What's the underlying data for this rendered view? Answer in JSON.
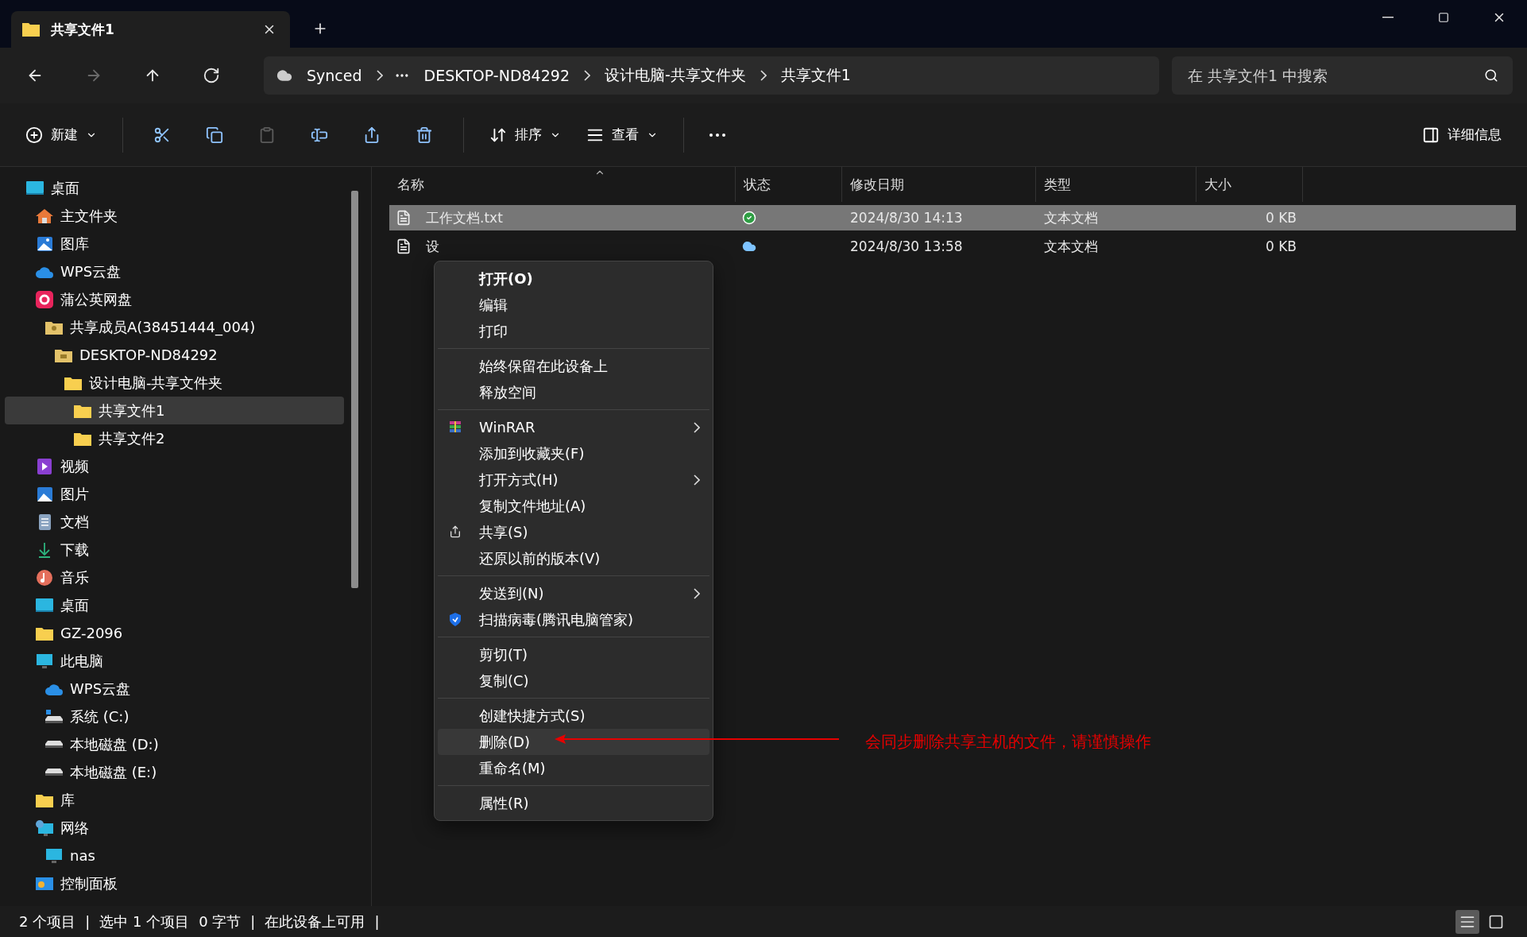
{
  "window": {
    "tab_title": "共享文件1"
  },
  "nav": [
    {
      "kind": "back",
      "disabled": false
    },
    {
      "kind": "forward",
      "disabled": true
    },
    {
      "kind": "up",
      "disabled": false
    },
    {
      "kind": "refresh",
      "disabled": false
    }
  ],
  "address": {
    "root": "Synced",
    "crumbs": [
      "DESKTOP-ND84292",
      "设计电脑-共享文件夹",
      "共享文件1"
    ]
  },
  "search": {
    "placeholder": "在 共享文件1 中搜索"
  },
  "toolbar": {
    "new_label": "新建",
    "actions": [
      {
        "kind": "cut",
        "disabled": false
      },
      {
        "kind": "copy",
        "disabled": false
      },
      {
        "kind": "paste",
        "disabled": true
      },
      {
        "kind": "rename",
        "disabled": false
      },
      {
        "kind": "share",
        "disabled": false
      },
      {
        "kind": "delete",
        "disabled": false
      }
    ],
    "sort_label": "排序",
    "view_label": "查看",
    "details_label": "详细信息"
  },
  "sidebar": {
    "items": [
      {
        "label": "桌面",
        "kind": "desktop",
        "selected": false,
        "children": [
          {
            "label": "主文件夹",
            "kind": "home",
            "selected": false
          },
          {
            "label": "图库",
            "kind": "gallery",
            "selected": false
          },
          {
            "label": "WPS云盘",
            "kind": "cloud",
            "selected": false
          },
          {
            "label": "蒲公英网盘",
            "kind": "dandelion",
            "selected": false,
            "children": [
              {
                "label": "共享成员A(38451444_004)",
                "kind": "shared-folder",
                "selected": false,
                "children": [
                  {
                    "label": "DESKTOP-ND84292",
                    "kind": "pc-folder",
                    "selected": false,
                    "children": [
                      {
                        "label": "设计电脑-共享文件夹",
                        "kind": "folder",
                        "selected": false,
                        "children": [
                          {
                            "label": "共享文件1",
                            "kind": "folder",
                            "selected": true
                          },
                          {
                            "label": "共享文件2",
                            "kind": "folder",
                            "selected": false
                          }
                        ]
                      }
                    ]
                  }
                ]
              }
            ]
          },
          {
            "label": "视频",
            "kind": "video",
            "selected": false
          },
          {
            "label": "图片",
            "kind": "pictures",
            "selected": false
          },
          {
            "label": "文档",
            "kind": "docs",
            "selected": false
          },
          {
            "label": "下载",
            "kind": "download",
            "selected": false
          },
          {
            "label": "音乐",
            "kind": "music",
            "selected": false
          },
          {
            "label": "桌面",
            "kind": "desktop",
            "selected": false
          },
          {
            "label": "GZ-2096",
            "kind": "folder",
            "selected": false
          },
          {
            "label": "此电脑",
            "kind": "pc",
            "selected": false,
            "children": [
              {
                "label": "WPS云盘",
                "kind": "cloud",
                "selected": false
              },
              {
                "label": "系统 (C:)",
                "kind": "drive-c",
                "selected": false
              },
              {
                "label": "本地磁盘 (D:)",
                "kind": "drive",
                "selected": false
              },
              {
                "label": "本地磁盘 (E:)",
                "kind": "drive",
                "selected": false
              }
            ]
          },
          {
            "label": "库",
            "kind": "folder",
            "selected": false
          },
          {
            "label": "网络",
            "kind": "network",
            "selected": false,
            "children": [
              {
                "label": "nas",
                "kind": "pc",
                "selected": false
              }
            ]
          },
          {
            "label": "控制面板",
            "kind": "control",
            "selected": false
          }
        ]
      }
    ]
  },
  "table": {
    "columns": [
      "名称",
      "状态",
      "修改日期",
      "类型",
      "大小"
    ],
    "rows": [
      {
        "name": "工作文档.txt",
        "synced": true,
        "date": "2024/8/30 14:13",
        "type": "文本文档",
        "size": "0 KB",
        "selected": true
      },
      {
        "name": "设",
        "synced": false,
        "date": "2024/8/30 13:58",
        "type": "文本文档",
        "size": "0 KB",
        "selected": false
      }
    ]
  },
  "context_menu": {
    "groups": [
      [
        {
          "label": "打开(O)",
          "kind": "plain",
          "default": true,
          "submenu": false,
          "highlighted": false
        },
        {
          "label": "编辑",
          "kind": "plain",
          "default": false,
          "submenu": false,
          "highlighted": false
        },
        {
          "label": "打印",
          "kind": "plain",
          "default": false,
          "submenu": false,
          "highlighted": false
        }
      ],
      [
        {
          "label": "始终保留在此设备上",
          "kind": "plain",
          "default": false,
          "submenu": false,
          "highlighted": false
        },
        {
          "label": "释放空间",
          "kind": "plain",
          "default": false,
          "submenu": false,
          "highlighted": false
        }
      ],
      [
        {
          "label": "WinRAR",
          "kind": "winrar",
          "default": false,
          "submenu": true,
          "highlighted": false
        },
        {
          "label": "添加到收藏夹(F)",
          "kind": "plain",
          "default": false,
          "submenu": false,
          "highlighted": false
        },
        {
          "label": "打开方式(H)",
          "kind": "plain",
          "default": false,
          "submenu": true,
          "highlighted": false
        },
        {
          "label": "复制文件地址(A)",
          "kind": "plain",
          "default": false,
          "submenu": false,
          "highlighted": false
        },
        {
          "label": "共享(S)",
          "kind": "share",
          "default": false,
          "submenu": false,
          "highlighted": false
        },
        {
          "label": "还原以前的版本(V)",
          "kind": "plain",
          "default": false,
          "submenu": false,
          "highlighted": false
        }
      ],
      [
        {
          "label": "发送到(N)",
          "kind": "plain",
          "default": false,
          "submenu": true,
          "highlighted": false
        },
        {
          "label": "扫描病毒(腾讯电脑管家)",
          "kind": "shield",
          "default": false,
          "submenu": false,
          "highlighted": false
        }
      ],
      [
        {
          "label": "剪切(T)",
          "kind": "plain",
          "default": false,
          "submenu": false,
          "highlighted": false
        },
        {
          "label": "复制(C)",
          "kind": "plain",
          "default": false,
          "submenu": false,
          "highlighted": false
        }
      ],
      [
        {
          "label": "创建快捷方式(S)",
          "kind": "plain",
          "default": false,
          "submenu": false,
          "highlighted": false
        },
        {
          "label": "删除(D)",
          "kind": "plain",
          "default": false,
          "submenu": false,
          "highlighted": true
        },
        {
          "label": "重命名(M)",
          "kind": "plain",
          "default": false,
          "submenu": false,
          "highlighted": false
        }
      ],
      [
        {
          "label": "属性(R)",
          "kind": "plain",
          "default": false,
          "submenu": false,
          "highlighted": false
        }
      ]
    ]
  },
  "annotation": {
    "text": "会同步删除共享主机的文件，请谨慎操作",
    "color": "#e60000"
  },
  "status_bar": {
    "segments": [
      "2 个项目",
      "|",
      "选中 1 个项目",
      "0 字节",
      "|",
      "在此设备上可用",
      "|"
    ],
    "views": [
      {
        "kind": "details",
        "selected": true
      },
      {
        "kind": "tiles",
        "selected": false
      }
    ]
  }
}
